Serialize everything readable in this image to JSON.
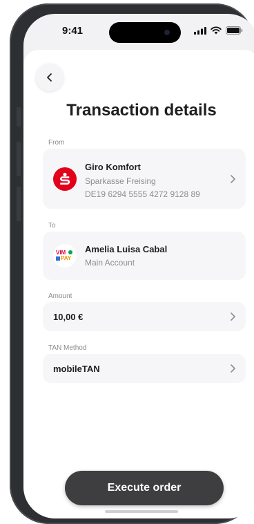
{
  "status_bar": {
    "time": "9:41"
  },
  "header": {
    "title": "Transaction details"
  },
  "from": {
    "label": "From",
    "account_name": "Giro Komfort",
    "bank": "Sparkasse Freising",
    "iban": "DE19 6294 5555 4272 9128 89",
    "logo_icon": "sparkasse-logo-icon",
    "logo_color": "#e2001a"
  },
  "to": {
    "label": "To",
    "name": "Amelia Luisa Cabal",
    "account": "Main Account",
    "logo_icon": "vimpay-logo-icon",
    "logo_text_top": "VIM",
    "logo_text_bottom": "PAY"
  },
  "amount": {
    "label": "Amount",
    "value": "10,00 €"
  },
  "tan": {
    "label": "TAN Method",
    "value": "mobileTAN"
  },
  "actions": {
    "execute_label": "Execute order"
  },
  "colors": {
    "primary_button": "#3e3e40",
    "card_bg": "#f6f6f8",
    "accent_red": "#e2001a"
  }
}
